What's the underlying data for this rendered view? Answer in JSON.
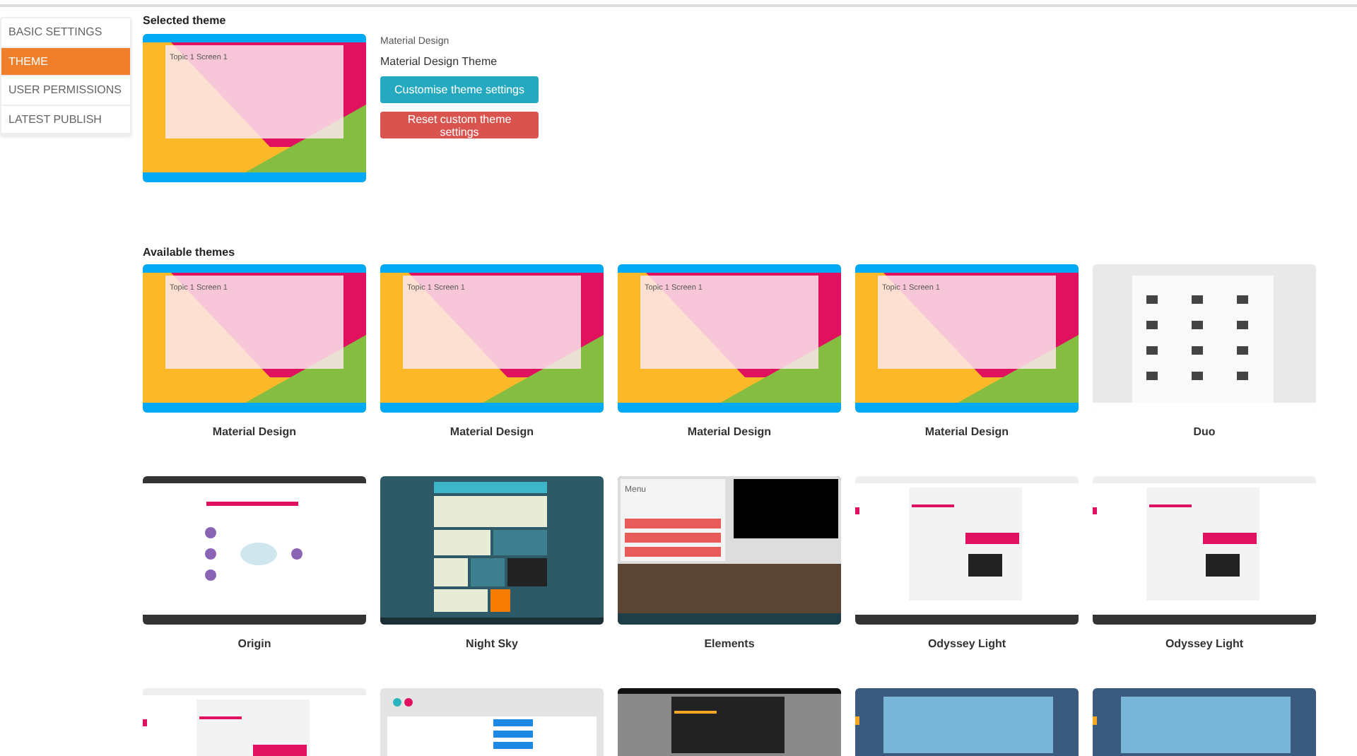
{
  "sidebar": {
    "items": [
      {
        "label": "BASIC SETTINGS",
        "selected": false
      },
      {
        "label": "THEME",
        "selected": true
      },
      {
        "label": "USER PERMISSIONS",
        "selected": false
      },
      {
        "label": "LATEST PUBLISH",
        "selected": false
      }
    ]
  },
  "selected_theme": {
    "heading": "Selected theme",
    "preview": {
      "kind": "material",
      "heading": "Topic 1 Screen 1"
    },
    "name": "Material Design",
    "description": "Material Design Theme",
    "buttons": [
      {
        "label": "Customise theme settings",
        "kind": "primary"
      },
      {
        "label": "Reset custom theme settings",
        "kind": "danger"
      }
    ]
  },
  "available_themes": {
    "heading": "Available themes",
    "themes": [
      {
        "name": "Material Design",
        "preview": {
          "kind": "material",
          "heading": "Topic 1 Screen 1"
        }
      },
      {
        "name": "Material Design",
        "preview": {
          "kind": "material",
          "heading": "Topic 1 Screen 1"
        }
      },
      {
        "name": "Material Design",
        "preview": {
          "kind": "material",
          "heading": "Topic 1 Screen 1"
        }
      },
      {
        "name": "Material Design",
        "preview": {
          "kind": "material",
          "heading": "Topic 1 Screen 1"
        }
      },
      {
        "name": "Duo",
        "preview": {
          "kind": "duo"
        }
      },
      {
        "name": "Origin",
        "preview": {
          "kind": "origin"
        }
      },
      {
        "name": "Night Sky",
        "preview": {
          "kind": "nightsky"
        }
      },
      {
        "name": "Elements",
        "preview": {
          "kind": "elements",
          "heading": "Menu"
        }
      },
      {
        "name": "Odyssey Light",
        "preview": {
          "kind": "odyssey"
        }
      },
      {
        "name": "Odyssey Light",
        "preview": {
          "kind": "odyssey"
        }
      },
      {
        "preview": {
          "kind": "odyssey"
        }
      },
      {
        "preview": {
          "kind": "gomo"
        }
      },
      {
        "preview": {
          "kind": "dark"
        }
      },
      {
        "preview": {
          "kind": "blue"
        }
      },
      {
        "preview": {
          "kind": "blue"
        }
      }
    ]
  }
}
